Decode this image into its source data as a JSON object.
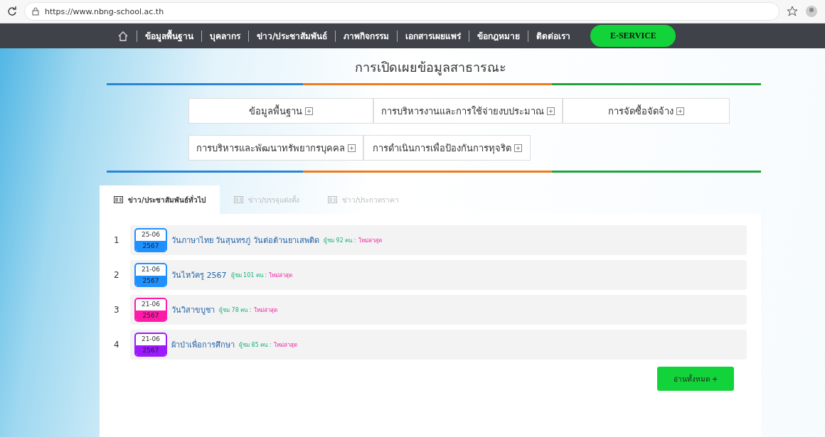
{
  "browser": {
    "url": "https://www.nbng-school.ac.th"
  },
  "nav": {
    "items": [
      "ข้อมูลพื้นฐาน",
      "บุคลากร",
      "ข่าว/ประชาสัมพันธ์",
      "ภาพกิจกรรม",
      "เอกสารเผยแพร่",
      "ข้อกฎหมาย",
      "ติดต่อเรา"
    ],
    "service_button": "E-SERVICE"
  },
  "disclosure": {
    "title": "การเปิดเผยข้อมูลสาธารณะ",
    "rows": [
      [
        "ข้อมูลพื้นฐาน",
        "การบริหารงานและการใช้จ่ายงบประมาณ",
        "การจัดซื้อจัดจ้าง"
      ],
      [
        "การบริหารและพัฒนาทรัพยากรบุคคล",
        "การดำเนินการเพื่อป้องกันการทุจริต"
      ]
    ]
  },
  "tabs": [
    {
      "label": "ข่าว/ประชาสัมพันธ์ทั่วไป",
      "selected": true
    },
    {
      "label": "ข่าว/บรรจุแต่งตั้ง",
      "selected": false
    },
    {
      "label": "ข่าว/ประกวดราคา",
      "selected": false
    }
  ],
  "news": [
    {
      "number": "1",
      "date": "25-06",
      "year": "2567",
      "color": "#1e90ff",
      "title": "วันภาษาไทย วันสุนทรภู่ วันต่อต้านยาเสพติด",
      "views": "ผู้ชม 92 คน :",
      "tag": "ใหม่ล่าสุด"
    },
    {
      "number": "2",
      "date": "21-06",
      "year": "2567",
      "color": "#1e90ff",
      "title": "วันไหว้ครู 2567",
      "views": "ผู้ชม 101 คน :",
      "tag": "ใหม่ล่าสุด"
    },
    {
      "number": "3",
      "date": "21-06",
      "year": "2567",
      "color": "#ff1aa8",
      "title": "วันวิสาขบูชา",
      "views": "ผู้ชม 78 คน :",
      "tag": "ใหม่ล่าสุด"
    },
    {
      "number": "4",
      "date": "21-06",
      "year": "2567",
      "color": "#9b1aff",
      "title": "ผ้าป่าเพื่อการศึกษา",
      "views": "ผู้ชม 85 คน :",
      "tag": "ใหม่ล่าสุด"
    }
  ],
  "read_all_button": "อ่านทั้งหมด +"
}
